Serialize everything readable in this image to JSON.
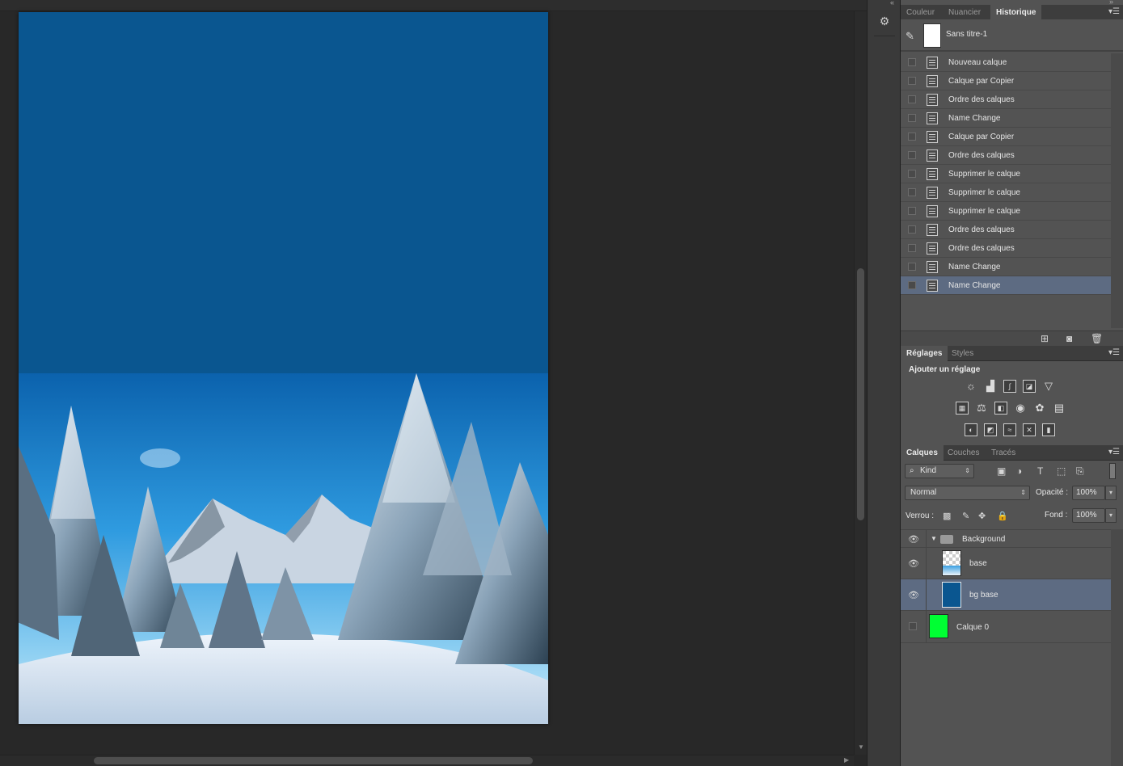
{
  "panel_tabs_top": [
    "Couleur",
    "Nuancier",
    "Historique"
  ],
  "history": {
    "snapshot": "Sans titre-1",
    "items": [
      "Nouveau calque",
      "Calque par Copier",
      "Ordre des calques",
      "Name Change",
      "Calque par Copier",
      "Ordre des calques",
      "Supprimer le calque",
      "Supprimer le calque",
      "Supprimer le calque",
      "Ordre des calques",
      "Ordre des calques",
      "Name Change",
      "Name Change"
    ],
    "selected_index": 12
  },
  "adjustments": {
    "tabs": [
      "Réglages",
      "Styles"
    ],
    "title": "Ajouter un réglage"
  },
  "layers": {
    "tabs": [
      "Calques",
      "Couches",
      "Tracés"
    ],
    "filter": "Kind",
    "blend_mode": "Normal",
    "opacity_label": "Opacité :",
    "opacity": "100%",
    "lock_label": "Verrou :",
    "fill_label": "Fond :",
    "fill": "100%",
    "group": "Background",
    "items": [
      {
        "name": "base",
        "visible": true,
        "thumb": "photo"
      },
      {
        "name": "bg base",
        "visible": true,
        "thumb": "#0a5690",
        "selected": true
      },
      {
        "name": "Calque 0",
        "visible": false,
        "thumb": "#00ff33"
      }
    ]
  },
  "colors": {
    "doc_sky": "#0a5690",
    "selection": "#5d6b82",
    "calque0": "#00ff33"
  }
}
